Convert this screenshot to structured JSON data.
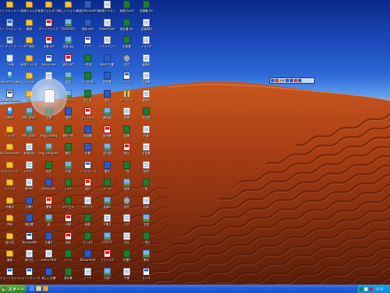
{
  "taskbar": {
    "start_label": "スタート",
    "quick_launch": [
      {
        "name": "ie-icon",
        "color": "#3a8ee6"
      },
      {
        "name": "desktop-icon",
        "color": "#e9d27a"
      },
      {
        "name": "media-icon",
        "color": "#f0a020"
      }
    ],
    "tray": {
      "icons": [
        {
          "name": "network-icon",
          "color": "#1e7b34"
        },
        {
          "name": "volume-icon",
          "color": "#dfe9f4"
        },
        {
          "name": "security-icon",
          "color": "#d21"
        }
      ],
      "clock": "14:33"
    }
  },
  "language_bar": {
    "label": "あ般"
  },
  "desktop_icons": [
    {
      "label": "マイ ドキュメント",
      "type": "folder"
    },
    {
      "label": "新規フォルダ",
      "type": "folder"
    },
    {
      "label": "新規フォルダ (2)",
      "type": "folder"
    },
    {
      "label": "新しいフォルダ",
      "type": "folder"
    },
    {
      "label": "新規 Microsoft Word",
      "type": "word"
    },
    {
      "label": "新規テキスト",
      "type": "doc"
    },
    {
      "label": "新規 Excel",
      "type": "excel"
    },
    {
      "label": "見積書.xls",
      "type": "excel"
    },
    {
      "label": "マイ コンピュータ",
      "type": "computer"
    },
    {
      "label": "書類",
      "type": "folder"
    },
    {
      "label": "ポートフォリオ",
      "type": "pdf"
    },
    {
      "label": "TS300002",
      "type": "img"
    },
    {
      "label": "資料.doc",
      "type": "word"
    },
    {
      "label": "PowerPoint",
      "type": "doc"
    },
    {
      "label": "報告書.xls",
      "type": "excel"
    },
    {
      "label": "会議資料",
      "type": "doc"
    },
    {
      "label": "マイ ネットワーク",
      "type": "computer"
    },
    {
      "label": "NTT資料",
      "type": "folder"
    },
    {
      "label": "文書.pdf",
      "type": "pdf"
    },
    {
      "label": "画像.jpg",
      "type": "img"
    },
    {
      "label": "アプリ",
      "type": "app"
    },
    {
      "label": "ドキュメント",
      "type": "doc"
    },
    {
      "label": "計算書",
      "type": "excel"
    },
    {
      "label": "メモ.txt",
      "type": "doc"
    },
    {
      "label": "ごみ箱",
      "type": "recycle"
    },
    {
      "label": "新規フォルダ",
      "type": "folder"
    },
    {
      "label": "Setup.exe",
      "type": "app"
    },
    {
      "label": "資料.pdf",
      "type": "pdf"
    },
    {
      "label": "一覧表",
      "type": "excel"
    },
    {
      "label": "Word 文書",
      "type": "word"
    },
    {
      "label": "設定",
      "type": "gear"
    },
    {
      "label": "議事録",
      "type": "doc"
    },
    {
      "label": "Internet Explorer",
      "type": "ie"
    },
    {
      "label": "フォルダ",
      "type": "folder"
    },
    {
      "label": "手順書",
      "type": "doc"
    },
    {
      "label": "図面",
      "type": "img"
    },
    {
      "label": "データ.xls",
      "type": "excel"
    },
    {
      "label": "提案書",
      "type": "word"
    },
    {
      "label": "ツール",
      "type": "app"
    },
    {
      "label": "仕様書",
      "type": "doc"
    },
    {
      "label": "Outlook Express",
      "type": "app"
    },
    {
      "label": "企画",
      "type": "folder"
    },
    {
      "label": "請求書",
      "type": "pdf"
    },
    {
      "label": "スキャン",
      "type": "img"
    },
    {
      "label": "売上表",
      "type": "excel"
    },
    {
      "label": "案内",
      "type": "word"
    },
    {
      "label": "アーカイブ",
      "type": "zip"
    },
    {
      "label": "連絡先",
      "type": "doc"
    },
    {
      "label": "Safari",
      "type": "ie"
    },
    {
      "label": "IMG_0001",
      "type": "img"
    },
    {
      "label": "名簿",
      "type": "excel"
    },
    {
      "label": "通知",
      "type": "word"
    },
    {
      "label": "マニュアル",
      "type": "pdf"
    },
    {
      "label": "構成図",
      "type": "img"
    },
    {
      "label": "原稿",
      "type": "doc"
    },
    {
      "label": "予定表",
      "type": "excel"
    },
    {
      "label": "フォルダ",
      "type": "folder"
    },
    {
      "label": "IMG_0002",
      "type": "img"
    },
    {
      "label": "img_catalog",
      "type": "img"
    },
    {
      "label": "資料一覧",
      "type": "excel"
    },
    {
      "label": "申請書",
      "type": "word"
    },
    {
      "label": "説明書",
      "type": "pdf"
    },
    {
      "label": "見積",
      "type": "excel"
    },
    {
      "label": "作業",
      "type": "doc"
    },
    {
      "label": "My Documents",
      "type": "folder"
    },
    {
      "label": "新規作成",
      "type": "doc"
    },
    {
      "label": "img_computer",
      "type": "img"
    },
    {
      "label": "集計",
      "type": "excel"
    },
    {
      "label": "文書",
      "type": "word"
    },
    {
      "label": "案内図",
      "type": "img"
    },
    {
      "label": "報告",
      "type": "pdf"
    },
    {
      "label": "計画書",
      "type": "doc"
    },
    {
      "label": "デスクトップ",
      "type": "folder"
    },
    {
      "label": "テキスト",
      "type": "doc"
    },
    {
      "label": "名前",
      "type": "excel"
    },
    {
      "label": "写真",
      "type": "img"
    },
    {
      "label": "インストール",
      "type": "app"
    },
    {
      "label": "書式",
      "type": "word"
    },
    {
      "label": "一覧",
      "type": "excel"
    },
    {
      "label": "説明",
      "type": "doc"
    },
    {
      "label": "ファイル",
      "type": "folder"
    },
    {
      "label": "MEMO",
      "type": "doc"
    },
    {
      "label": "memo.doc",
      "type": "word"
    },
    {
      "label": "リスト",
      "type": "excel"
    },
    {
      "label": "資料",
      "type": "pdf"
    },
    {
      "label": "データ",
      "type": "excel"
    },
    {
      "label": "画像",
      "type": "img"
    },
    {
      "label": "表",
      "type": "excel"
    },
    {
      "label": "作業用",
      "type": "folder"
    },
    {
      "label": "文書1",
      "type": "word"
    },
    {
      "label": "書類",
      "type": "pdf"
    },
    {
      "label": "エクセル",
      "type": "excel"
    },
    {
      "label": "レポート",
      "type": "doc"
    },
    {
      "label": "画像2",
      "type": "img"
    },
    {
      "label": "設定",
      "type": "gear"
    },
    {
      "label": "記録",
      "type": "doc"
    },
    {
      "label": "共有",
      "type": "folder"
    },
    {
      "label": "報告書",
      "type": "word"
    },
    {
      "label": "図",
      "type": "img"
    },
    {
      "label": "印刷",
      "type": "pdf"
    },
    {
      "label": "帳票",
      "type": "excel"
    },
    {
      "label": "下書き",
      "type": "doc"
    },
    {
      "label": "ログ",
      "type": "doc"
    },
    {
      "label": "名刺",
      "type": "img"
    },
    {
      "label": "個人用",
      "type": "folder"
    },
    {
      "label": "TerminalPS",
      "type": "app"
    },
    {
      "label": "文書2",
      "type": "word"
    },
    {
      "label": "表紙",
      "type": "pdf"
    },
    {
      "label": "データ2",
      "type": "excel"
    },
    {
      "label": "FFFFFF",
      "type": "img"
    },
    {
      "label": "予定",
      "type": "doc"
    },
    {
      "label": "一覧2",
      "type": "excel"
    },
    {
      "label": "業務",
      "type": "folder"
    },
    {
      "label": "取引先",
      "type": "doc"
    },
    {
      "label": "nodes.html",
      "type": "doc"
    },
    {
      "label": "シート",
      "type": "excel"
    },
    {
      "label": "Documents",
      "type": "word"
    },
    {
      "label": "ファイル2",
      "type": "pdf"
    },
    {
      "label": "名簿2",
      "type": "excel"
    },
    {
      "label": "素材",
      "type": "img"
    },
    {
      "label": "ショートカット",
      "type": "app"
    },
    {
      "label": "ショートカット2",
      "type": "app"
    },
    {
      "label": "新しい文書",
      "type": "word"
    },
    {
      "label": "表計算",
      "type": "excel"
    },
    {
      "label": "ノート",
      "type": "doc"
    },
    {
      "label": "写真2",
      "type": "img"
    },
    {
      "label": "手順",
      "type": "doc"
    },
    {
      "label": "メール",
      "type": "app"
    }
  ]
}
